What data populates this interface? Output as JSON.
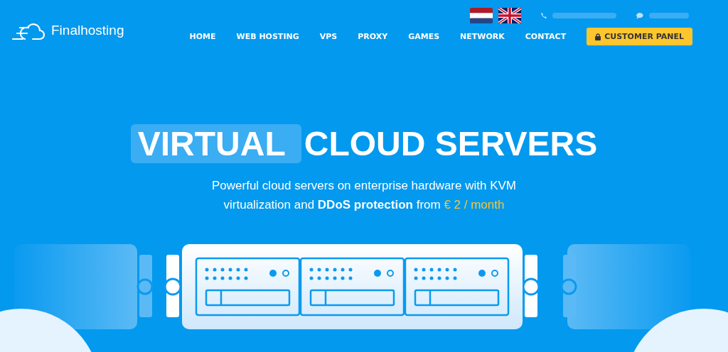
{
  "logo": {
    "text": "Finalhosting"
  },
  "nav": [
    {
      "label": "HOME"
    },
    {
      "label": "WEB HOSTING"
    },
    {
      "label": "VPS"
    },
    {
      "label": "PROXY"
    },
    {
      "label": "GAMES"
    },
    {
      "label": "NETWORK"
    },
    {
      "label": "CONTACT"
    }
  ],
  "customer_panel_button": {
    "label": "CUSTOMER PANEL"
  },
  "hero": {
    "title_highlight": "VIRTUAL",
    "title_rest": "CLOUD SERVERS",
    "subtitle": "Powerful cloud servers on enterprise hardware with KVM virtualization and **DDoS protection** from",
    "price": "€ 2 / month"
  }
}
